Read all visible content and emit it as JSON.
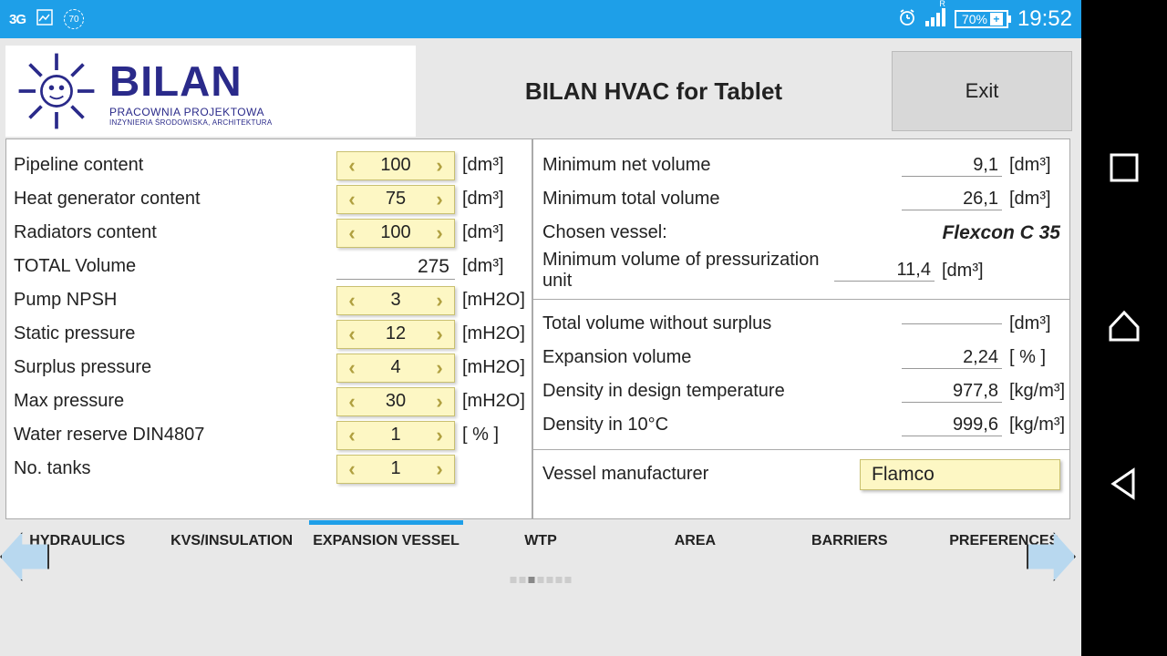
{
  "status": {
    "net": "3G",
    "circ": "70",
    "r": "R",
    "batt": "70%",
    "time": "19:52"
  },
  "header": {
    "logo_main": "BILAN",
    "logo_sub": "PRACOWNIA PROJEKTOWA",
    "logo_sub2": "INŻYNIERIA ŚRODOWISKA, ARCHITEKTURA",
    "title": "BILAN HVAC for Tablet",
    "exit": "Exit"
  },
  "left": {
    "rows": [
      {
        "label": "Pipeline content",
        "value": "100",
        "unit": "[dm³]",
        "stepper": true
      },
      {
        "label": "Heat generator content",
        "value": "75",
        "unit": "[dm³]",
        "stepper": true
      },
      {
        "label": "Radiators content",
        "value": "100",
        "unit": "[dm³]",
        "stepper": true
      },
      {
        "label": "TOTAL Volume",
        "value": "275",
        "unit": "[dm³]",
        "stepper": false
      },
      {
        "label": "Pump NPSH",
        "value": "3",
        "unit": "[mH2O]",
        "stepper": true
      },
      {
        "label": "Static pressure",
        "value": "12",
        "unit": "[mH2O]",
        "stepper": true
      },
      {
        "label": "Surplus pressure",
        "value": "4",
        "unit": "[mH2O]",
        "stepper": true
      },
      {
        "label": "Max pressure",
        "value": "30",
        "unit": "[mH2O]",
        "stepper": true
      },
      {
        "label": "Water reserve DIN4807",
        "value": "1",
        "unit": "[ % ]",
        "stepper": true
      },
      {
        "label": "No. tanks",
        "value": "1",
        "unit": "",
        "stepper": true
      }
    ]
  },
  "right": {
    "block1": [
      {
        "label": "Minimum net volume",
        "value": "9,1",
        "unit": "[dm³]"
      },
      {
        "label": "Minimum total volume",
        "value": "26,1",
        "unit": "[dm³]"
      }
    ],
    "chosen_label": "Chosen vessel:",
    "chosen_value": "Flexcon C 35",
    "block1b": [
      {
        "label": "Minimum volume of pressurization unit",
        "value": "11,4",
        "unit": "[dm³]"
      }
    ],
    "block2": [
      {
        "label": "Total volume without surplus",
        "value": "",
        "unit": "[dm³]"
      },
      {
        "label": "Expansion volume",
        "value": "2,24",
        "unit": "[ % ]"
      },
      {
        "label": "Density in design temperature",
        "value": "977,8",
        "unit": "[kg/m³]"
      },
      {
        "label": "Density in 10°C",
        "value": "999,6",
        "unit": "[kg/m³]"
      }
    ],
    "mfr_label": "Vessel manufacturer",
    "mfr_value": "Flamco"
  },
  "tabs": [
    "HYDRAULICS",
    "KVS/INSULATION",
    "EXPANSION VESSEL",
    "WTP",
    "AREA",
    "BARRIERS",
    "PREFERENCES"
  ],
  "active_tab": 2
}
